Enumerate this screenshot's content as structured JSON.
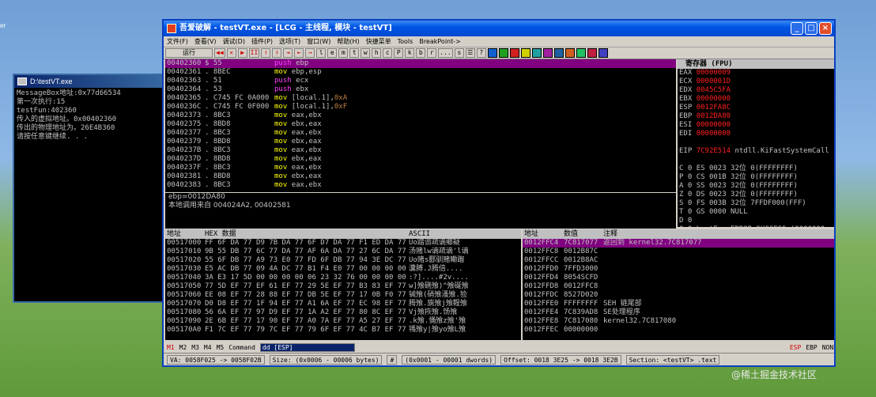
{
  "desktop": {
    "left_text": "er",
    "watermark": "@稀土掘金技术社区"
  },
  "console": {
    "title": "D:\\testVT.exe",
    "lines": [
      "MessageBox地址:0x77d66534",
      "第一次执行:15",
      "testFun:402360",
      "传入的虚拟地址。0x00402360",
      "传出的物理地址为。26E4B360",
      "请按任意键继续. . ."
    ]
  },
  "window": {
    "title": "吾爱破解 - testVT.exe - [LCG - 主线程, 模块 - testVT]",
    "buttons": {
      "min": "_",
      "max": "□",
      "close": "×"
    },
    "menu": [
      "文件(F)",
      "查看(V)",
      "调试(D)",
      "插件(P)",
      "选项(T)",
      "窗口(W)",
      "帮助(H)",
      "快捷菜单",
      "Tools",
      "BreakPoint->"
    ],
    "status": "运行",
    "toolbar_letters": [
      "l",
      "e",
      "m",
      "t",
      "w",
      "h",
      "c",
      "P",
      "k",
      "b",
      "r",
      "...",
      "s"
    ],
    "toolbar_glyphs": [
      "◀◀",
      "✕",
      "▶",
      "II",
      "ᚼ",
      "ᚼ",
      "⇥",
      "⇤",
      "→"
    ],
    "toolbar_right": [
      "☰",
      "?"
    ],
    "cpu_rows": [
      {
        "addr": "00402360",
        "hex": "$ 55",
        "op": "push",
        "args": "ebp",
        "comment": "",
        "sel": true
      },
      {
        "addr": "00402361",
        "hex": ". 8BEC",
        "op": "mov",
        "args": "ebp,esp",
        "comment": ""
      },
      {
        "addr": "00402363",
        "hex": ". 51",
        "op": "push",
        "args": "ecx",
        "comment": ""
      },
      {
        "addr": "00402364",
        "hex": ". 53",
        "op": "push",
        "args": "ebx",
        "comment": ""
      },
      {
        "addr": "00402365",
        "hex": ". C745 FC 0A000",
        "op": "mov",
        "args": "[local.1],",
        "imm": "0xA",
        "comment": ""
      },
      {
        "addr": "0040236C",
        "hex": ". C745 FC 0F000",
        "op": "mov",
        "args": "[local.1],",
        "imm": "0xF",
        "comment": ""
      },
      {
        "addr": "00402373",
        "hex": ". 8BC3",
        "op": "mov",
        "args": "eax,ebx",
        "comment": ""
      },
      {
        "addr": "00402375",
        "hex": ". 8BD8",
        "op": "mov",
        "args": "ebx,eax",
        "comment": ""
      },
      {
        "addr": "00402377",
        "hex": ". 8BC3",
        "op": "mov",
        "args": "eax,ebx",
        "comment": ""
      },
      {
        "addr": "00402379",
        "hex": ". 8BD8",
        "op": "mov",
        "args": "ebx,eax",
        "comment": ""
      },
      {
        "addr": "0040237B",
        "hex": ". 8BC3",
        "op": "mov",
        "args": "eax,ebx",
        "comment": ""
      },
      {
        "addr": "0040237D",
        "hex": ". 8BD8",
        "op": "mov",
        "args": "ebx,eax",
        "comment": ""
      },
      {
        "addr": "0040237F",
        "hex": ". 8BC3",
        "op": "mov",
        "args": "eax,ebx",
        "comment": ""
      },
      {
        "addr": "00402381",
        "hex": ". 8BD8",
        "op": "mov",
        "args": "ebx,eax",
        "comment": ""
      },
      {
        "addr": "00402383",
        "hex": ". 8BC3",
        "op": "mov",
        "args": "eax,ebx",
        "comment": ""
      }
    ],
    "info_lines": [
      "ebp=0012DA80",
      "本地调用来自 004024A2, 00402581"
    ],
    "registers": {
      "title": "寄存器 (FPU)",
      "rows": [
        {
          "n": "EAX",
          "v": "00000009"
        },
        {
          "n": "ECX",
          "v": "0000001D"
        },
        {
          "n": "EDX",
          "v": "0045C5FA"
        },
        {
          "n": "EBX",
          "v": "00000000"
        },
        {
          "n": "ESP",
          "v": "0012FA8C"
        },
        {
          "n": "EBP",
          "v": "0012DA80"
        },
        {
          "n": "ESI",
          "v": "00000000"
        },
        {
          "n": "EDI",
          "v": "00000000"
        }
      ],
      "eip": {
        "n": "EIP",
        "v": "7C92E514",
        "c": "ntdll.KiFastSystemCall"
      },
      "segs": [
        {
          "f": "C 0",
          "s": "ES 0023 32位 0(FFFFFFFF)"
        },
        {
          "f": "P 0",
          "s": "CS 001B 32位 0(FFFFFFFF)"
        },
        {
          "f": "A 0",
          "s": "SS 0023 32位 0(FFFFFFFF)"
        },
        {
          "f": "Z 0",
          "s": "DS 0023 32位 0(FFFFFFFF)"
        },
        {
          "f": "S 0",
          "s": "FS 003B 32位 7FFDF000(FFF)"
        },
        {
          "f": "T 0",
          "s": "GS 0000 NULL"
        },
        {
          "f": "D 0",
          "s": ""
        },
        {
          "f": "O 0",
          "s": "LastErr ERROR_SUCCESS (0000000"
        }
      ]
    },
    "dump": {
      "headers": [
        "地址",
        "HEX 数据",
        "ASCII"
      ],
      "rows": [
        {
          "a": "00517000",
          "h": "FF 6F DA 77 D9 7B DA 77 6F D7 DA 77 F1 ED DA 77",
          "s": "Uo踏谫疏谪鄉疑"
        },
        {
          "a": "00517010",
          "h": "9B 55 DB 77 6C 77 DA 77 AF 6A DA 77 27 6C DA 77",
          "s": "汤赌lw谪疏谪'l谪"
        },
        {
          "a": "00517020",
          "h": "55 6F DB 77 A9 73 E0 77 FD 6F DB 77 94 3E DC 77",
          "s": "Uo赌s郾驯赌鳓蹓"
        },
        {
          "a": "00517030",
          "h": "E5 AC DB 77 09 4A DC 77 B1 F4 E0 77 00 00 00 00",
          "s": "瀵膊.J腾倍...."
        },
        {
          "a": "00517040",
          "h": "3A E3 17 5D 00 00 00 00 06 23 32 76 00 00 00 00",
          "s": ":?]....#2v...."
        },
        {
          "a": "00517050",
          "h": "77 5D EF 77 EF 61 EF 77 29 5E EF 77 B3 83 EF 77",
          "s": "w]飧硎飧)^飧硟飧"
        },
        {
          "a": "00517060",
          "h": "EE 08 EF 77 28 88 EF 77 DB 5E EF 77 17 0B F0 77",
          "s": "铖飧(硝飧溞飧.猃"
        },
        {
          "a": "00517070",
          "h": "D0 D8 EF 77 1F 94 EF 77 A1 6A EF 77 EC 98 EF 77",
          "s": "腾飧.旐飧j飧鞓飧"
        },
        {
          "a": "00517080",
          "h": "56 6A EF 77 97 D9 EF 77 1A A2 EF 77 80 8C EF 77",
          "s": "Vj飧拻飧.饧飧"
        },
        {
          "a": "00517090",
          "h": "2E 6B EF 77 17 90 EF 77 A0 7A EF 77 A5 27 EF 77",
          "s": ".k飧.悀飧z飧'飧"
        },
        {
          "a": "005170A0",
          "h": "F1 7C EF 77 79 7C EF 77 79 6F EF 77 4C B7 EF 77",
          "s": "駂飧y|飧yo飧L飧"
        }
      ]
    },
    "stack": {
      "headers": [
        "地址",
        "数值",
        "注释"
      ],
      "rows": [
        {
          "a": "0012FFC4",
          "v": "7C817077",
          "c": "返回到 kernel32.7C817077",
          "sel": true
        },
        {
          "a": "0012FFC8",
          "v": "0012B87C",
          "c": ""
        },
        {
          "a": "0012FFCC",
          "v": "0012B8AC",
          "c": ""
        },
        {
          "a": "0012FFD0",
          "v": "7FFD3000",
          "c": ""
        },
        {
          "a": "0012FFD4",
          "v": "8054SCFD",
          "c": ""
        },
        {
          "a": "0012FFD8",
          "v": "0012FFC8",
          "c": ""
        },
        {
          "a": "0012FFDC",
          "v": "8527D020",
          "c": ""
        },
        {
          "a": "0012FFE0",
          "v": "FFFFFFFF",
          "c": "SEH 链尾部"
        },
        {
          "a": "0012FFE4",
          "v": "7C839AD8",
          "c": "SE处理程序"
        },
        {
          "a": "0012FFE8",
          "v": "7C817080",
          "c": "kernel32.7C817080"
        },
        {
          "a": "0012FFEC",
          "v": "00000000",
          "c": ""
        }
      ]
    },
    "bottom": {
      "tabs": [
        "M1",
        "M2",
        "M3",
        "M4",
        "M5"
      ],
      "command_label": "Command",
      "command_value": "dd [ESP]",
      "right": [
        "ESP",
        "EBP",
        "NONE"
      ]
    },
    "statusbar": [
      "VA: 0058F025 -> 0058F02B",
      "Size: (0x0006 - 00006 bytes)",
      "#",
      "(0x0001 - 00001 dwords)",
      "Offset: 0018 3E25 -> 0018 3E2B",
      "Section: <testVT> .text"
    ]
  }
}
